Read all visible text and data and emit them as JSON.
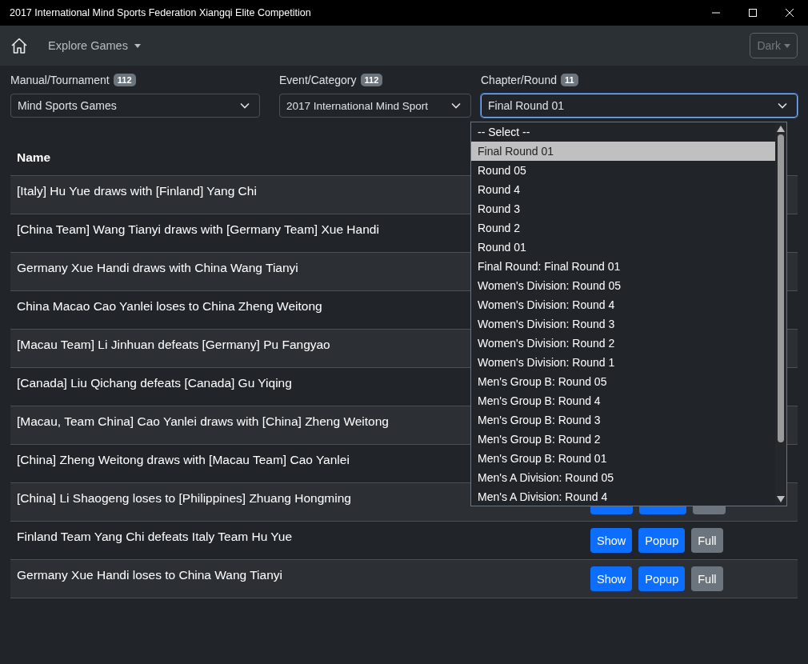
{
  "window": {
    "title": "2017 International Mind Sports Federation Xiangqi Elite Competition"
  },
  "navbar": {
    "menu": "Explore Games",
    "theme_button": "Dark"
  },
  "filters": [
    {
      "label": "Manual/Tournament",
      "count": "112",
      "value": "Mind Sports Games",
      "focused": false
    },
    {
      "label": "Event/Category",
      "count": "112",
      "value": "2017 International Mind Sport",
      "focused": false
    },
    {
      "label": "Chapter/Round",
      "count": "11",
      "value": "Final Round 01",
      "focused": true
    }
  ],
  "table": {
    "columns": [
      "Name"
    ],
    "rows": [
      {
        "name": "[Italy] Hu Yue draws with [Finland] Yang Chi",
        "buttons": []
      },
      {
        "name": "[China Team] Wang Tianyi draws with [Germany Team] Xue Handi",
        "buttons": []
      },
      {
        "name": "Germany Xue Handi draws with China Wang Tianyi",
        "buttons": []
      },
      {
        "name": "China Macao Cao Yanlei loses to China Zheng Weitong",
        "buttons": []
      },
      {
        "name": "[Macau Team] Li Jinhuan defeats [Germany] Pu Fangyao",
        "buttons": []
      },
      {
        "name": "[Canada] Liu Qichang defeats [Canada] Gu Yiqing",
        "buttons": []
      },
      {
        "name": "[Macau, Team China] Cao Yanlei draws with [China] Zheng Weitong",
        "buttons": []
      },
      {
        "name": "[China] Zheng Weitong draws with [Macau Team] Cao Yanlei",
        "buttons": []
      },
      {
        "name": "[China] Li Shaogeng loses to [Philippines] Zhuang Hongming",
        "buttons": [
          {
            "kind": "primary"
          },
          {
            "kind": "primary"
          },
          {
            "kind": "secondary"
          }
        ]
      },
      {
        "name": "Finland Team Yang Chi defeats Italy Team Hu Yue",
        "buttons": [
          {
            "kind": "primary",
            "label": "Show"
          },
          {
            "kind": "primary",
            "label": "Popup"
          },
          {
            "kind": "secondary",
            "label": "Full"
          }
        ]
      },
      {
        "name": "Germany Xue Handi loses to China Wang Tianyi",
        "buttons": [
          {
            "kind": "primary",
            "label": "Show"
          },
          {
            "kind": "primary",
            "label": "Popup"
          },
          {
            "kind": "secondary",
            "label": "Full"
          }
        ]
      }
    ]
  },
  "dropdown": {
    "options": [
      {
        "label": "-- Select --",
        "selected": false
      },
      {
        "label": "Final Round 01",
        "selected": true
      },
      {
        "label": "Round 05",
        "selected": false
      },
      {
        "label": "Round 4",
        "selected": false
      },
      {
        "label": "Round 3",
        "selected": false
      },
      {
        "label": "Round 2",
        "selected": false
      },
      {
        "label": "Round 01",
        "selected": false
      },
      {
        "label": "Final Round: Final Round 01",
        "selected": false
      },
      {
        "label": "Women's Division: Round 05",
        "selected": false
      },
      {
        "label": "Women's Division: Round 4",
        "selected": false
      },
      {
        "label": "Women's Division: Round 3",
        "selected": false
      },
      {
        "label": "Women's Division: Round 2",
        "selected": false
      },
      {
        "label": "Women's Division: Round 1",
        "selected": false
      },
      {
        "label": "Men's Group B: Round 05",
        "selected": false
      },
      {
        "label": "Men's Group B: Round 4",
        "selected": false
      },
      {
        "label": "Men's Group B: Round 3",
        "selected": false
      },
      {
        "label": "Men's Group B: Round 2",
        "selected": false
      },
      {
        "label": "Men's Group B: Round 01",
        "selected": false
      },
      {
        "label": "Men's A Division: Round 05",
        "selected": false
      },
      {
        "label": "Men's A Division: Round 4",
        "selected": false
      }
    ]
  }
}
